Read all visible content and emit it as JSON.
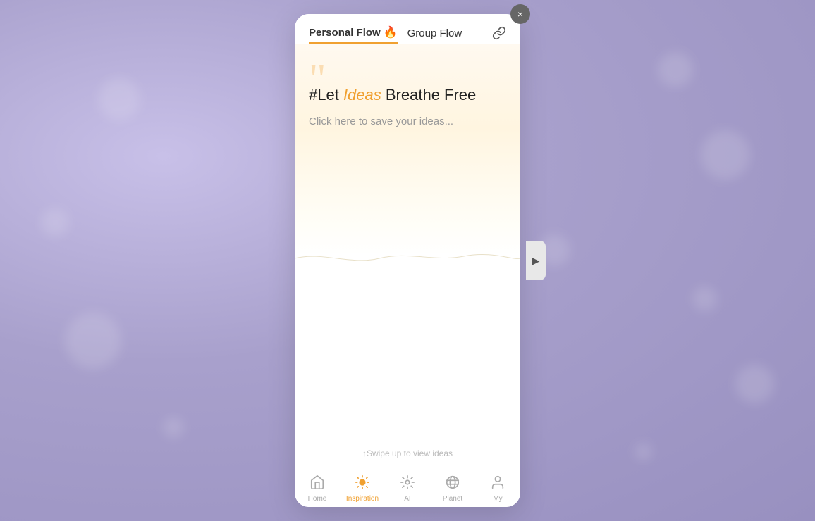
{
  "background": {
    "color": "#b0a8d0"
  },
  "modal": {
    "close_button_label": "×",
    "next_button_label": "▶"
  },
  "tabs": [
    {
      "id": "personal",
      "label": "Personal Flow",
      "emoji": "🔥",
      "active": true
    },
    {
      "id": "group",
      "label": "Group Flow",
      "emoji": "",
      "active": false
    }
  ],
  "link_icon": "🔗",
  "content": {
    "quote_mark": "“",
    "headline_prefix": "#Let ",
    "headline_highlight": "Ideas",
    "headline_suffix": " Breathe Free",
    "cta_text": "Click here to save your ideas..."
  },
  "swipe_hint": "↑Swipe up to view ideas",
  "bottom_nav": [
    {
      "id": "home",
      "icon": "⌂",
      "label": "Home",
      "active": false
    },
    {
      "id": "inspiration",
      "icon": "💡",
      "label": "Inspiration",
      "active": true
    },
    {
      "id": "ai",
      "icon": "✦",
      "label": "AI",
      "active": false
    },
    {
      "id": "planet",
      "icon": "◎",
      "label": "Planet",
      "active": false
    },
    {
      "id": "my",
      "icon": "👤",
      "label": "My",
      "active": false
    }
  ]
}
